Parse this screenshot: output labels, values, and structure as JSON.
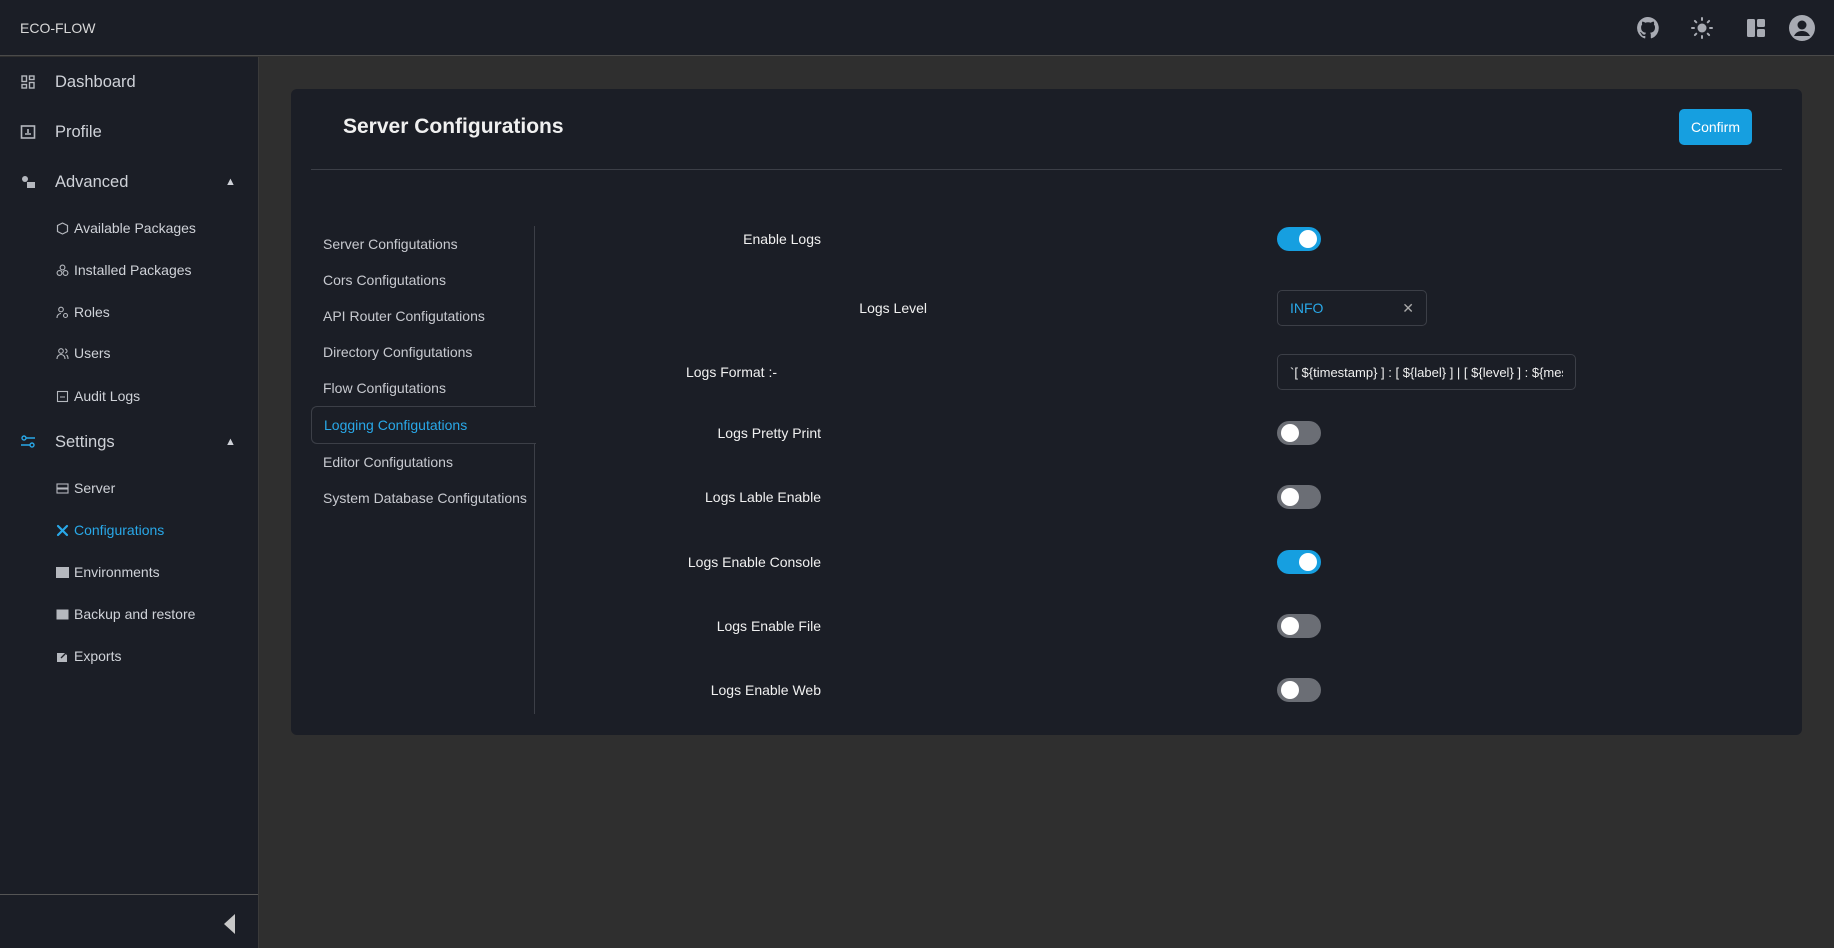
{
  "app": {
    "brand": "ECO-FLOW"
  },
  "topbar": {
    "icons": [
      "github-icon",
      "sun-icon",
      "layout-icon",
      "user-account-icon"
    ]
  },
  "sidebar": {
    "items": [
      {
        "label": "Dashboard",
        "icon": "dashboard-icon"
      },
      {
        "label": "Profile",
        "icon": "profile-icon"
      },
      {
        "label": "Advanced",
        "icon": "advanced-icon",
        "expanded": true
      },
      {
        "label": "Available Packages",
        "icon": "package-icon"
      },
      {
        "label": "Installed Packages",
        "icon": "packages-icon"
      },
      {
        "label": "Roles",
        "icon": "roles-icon"
      },
      {
        "label": "Users",
        "icon": "users-icon"
      },
      {
        "label": "Audit Logs",
        "icon": "audit-logs-icon"
      },
      {
        "label": "Settings",
        "icon": "settings-sliders-icon",
        "expanded": true
      },
      {
        "label": "Server",
        "icon": "server-icon"
      },
      {
        "label": "Configurations",
        "icon": "tools-icon",
        "active": true
      },
      {
        "label": "Environments",
        "icon": "env-file-icon"
      },
      {
        "label": "Backup and restore",
        "icon": "backup-icon"
      },
      {
        "label": "Exports",
        "icon": "export-icon"
      }
    ]
  },
  "main": {
    "title": "Server Configurations",
    "confirm_label": "Confirm",
    "tabs": [
      "Server Configutations",
      "Cors Configutations",
      "API Router Configutations",
      "Directory Configutations",
      "Flow Configutations",
      "Logging Configutations",
      "Editor Configutations",
      "System Database Configutations"
    ],
    "active_tab": "Logging Configutations",
    "form": {
      "enable_logs": {
        "label": "Enable Logs",
        "value": true
      },
      "logs_level": {
        "label": "Logs Level",
        "value": "INFO"
      },
      "logs_format": {
        "label": "Logs Format :-",
        "value": "`[ ${timestamp} ] : [ ${label} ] | [ ${level} ] : ${message}`"
      },
      "logs_pretty_print": {
        "label": "Logs Pretty Print",
        "value": false
      },
      "logs_lable_enable": {
        "label": "Logs Lable Enable",
        "value": false
      },
      "logs_enable_console": {
        "label": "Logs Enable Console",
        "value": true
      },
      "logs_enable_file": {
        "label": "Logs Enable File",
        "value": false
      },
      "logs_enable_web": {
        "label": "Logs Enable Web",
        "value": false
      }
    }
  },
  "colors": {
    "accent": "#169fe0",
    "surface": "#1b1e26",
    "background": "#2f2f2f"
  }
}
